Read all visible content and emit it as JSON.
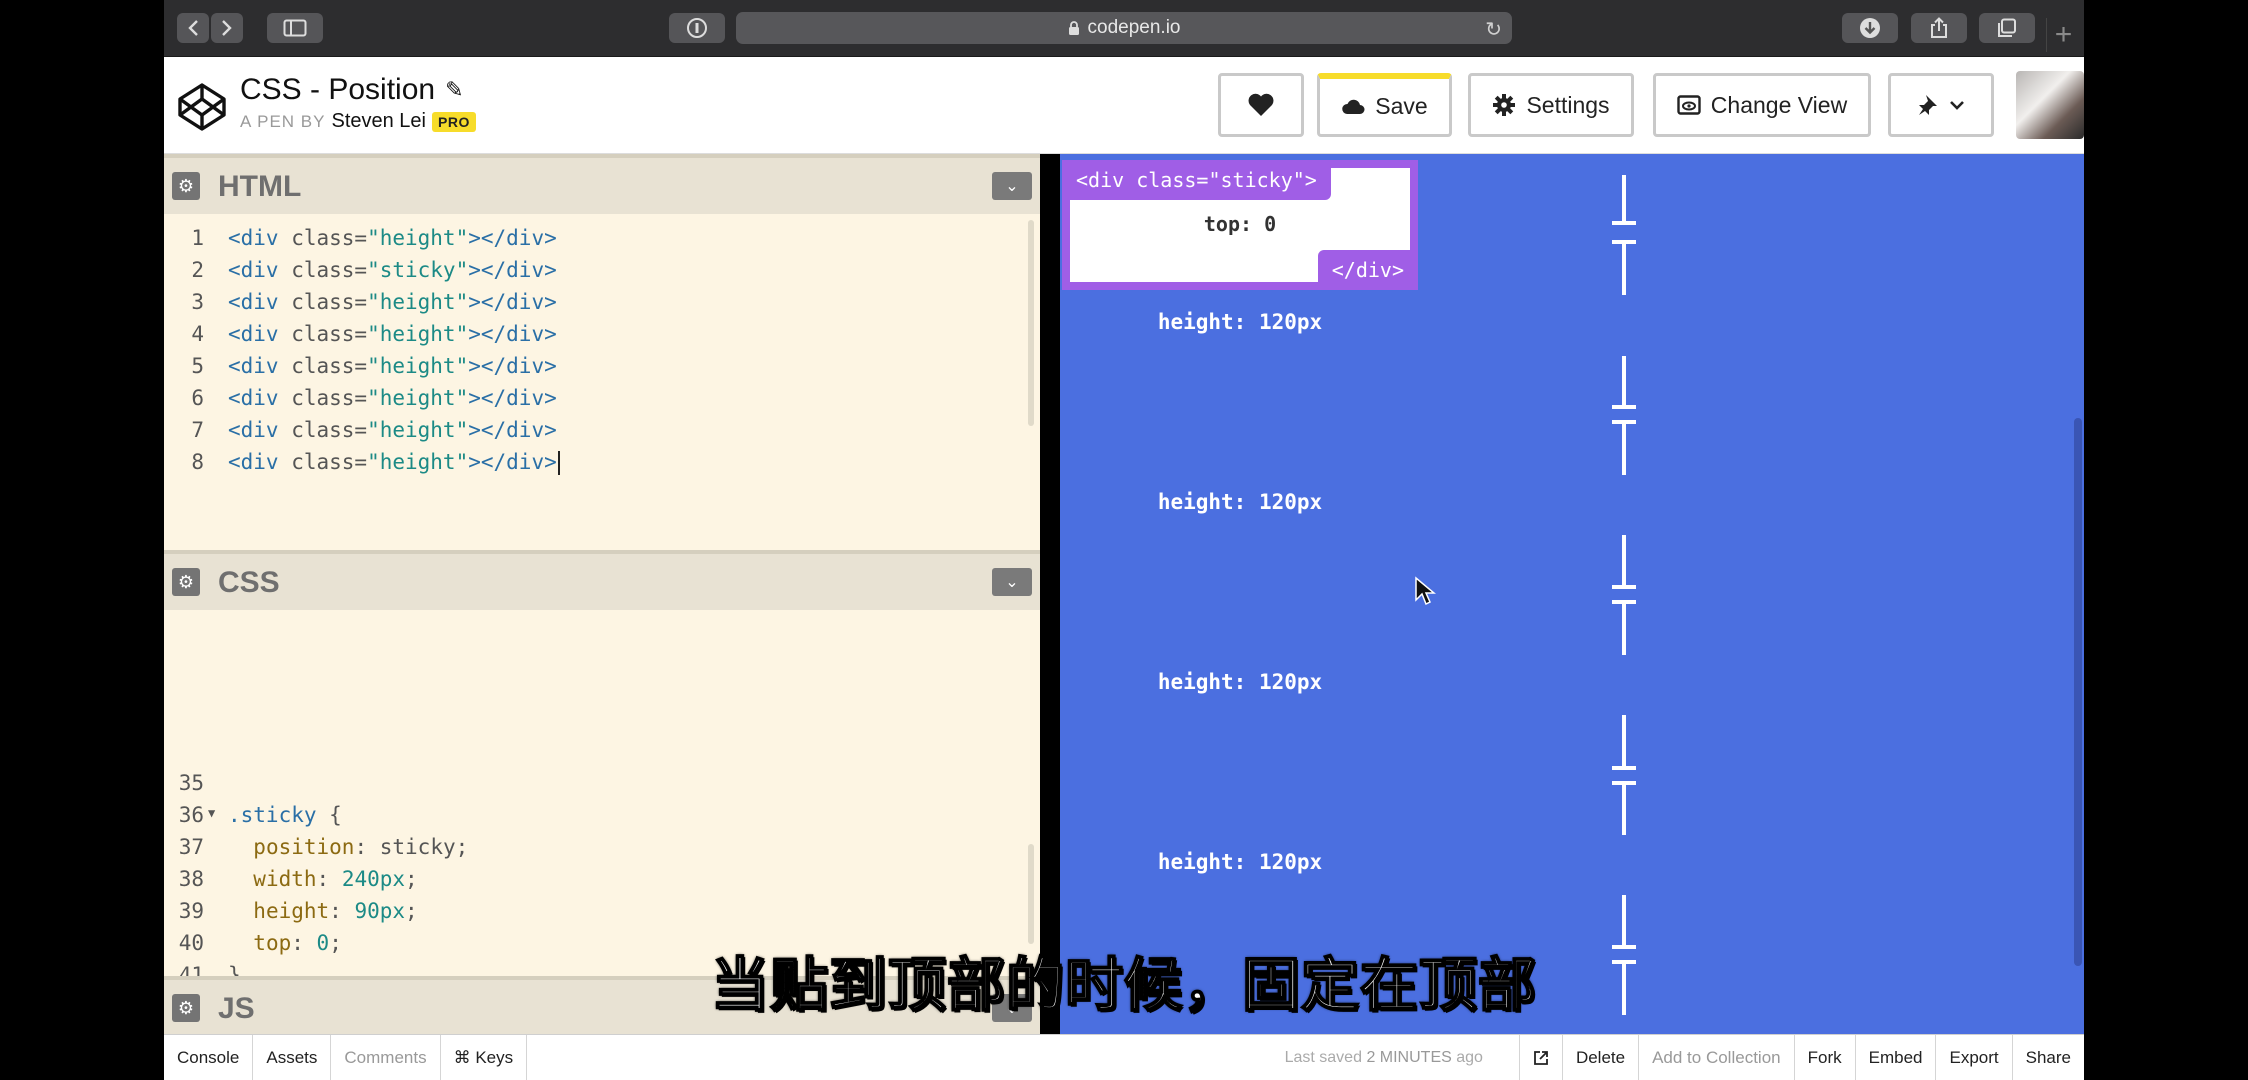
{
  "browser": {
    "url": "codepen.io"
  },
  "header": {
    "title": "CSS - Position",
    "byline_prefix": "A PEN BY",
    "author": "Steven Lei",
    "badge": "PRO",
    "buttons": {
      "save": "Save",
      "settings": "Settings",
      "change_view": "Change View"
    }
  },
  "html_editor": {
    "title": "HTML",
    "lines": [
      {
        "n": "1",
        "open": "<div ",
        "attr": "class=",
        "val": "\"height\"",
        "close": "></div>"
      },
      {
        "n": "2",
        "open": "<div ",
        "attr": "class=",
        "val": "\"sticky\"",
        "close": "></div>"
      },
      {
        "n": "3",
        "open": "<div ",
        "attr": "class=",
        "val": "\"height\"",
        "close": "></div>"
      },
      {
        "n": "4",
        "open": "<div ",
        "attr": "class=",
        "val": "\"height\"",
        "close": "></div>"
      },
      {
        "n": "5",
        "open": "<div ",
        "attr": "class=",
        "val": "\"height\"",
        "close": "></div>"
      },
      {
        "n": "6",
        "open": "<div ",
        "attr": "class=",
        "val": "\"height\"",
        "close": "></div>"
      },
      {
        "n": "7",
        "open": "<div ",
        "attr": "class=",
        "val": "\"height\"",
        "close": "></div>"
      },
      {
        "n": "8",
        "open": "<div ",
        "attr": "class=",
        "val": "\"height\"",
        "close": "></div>"
      }
    ]
  },
  "css_editor": {
    "title": "CSS",
    "line_numbers": [
      "35",
      "36",
      "37",
      "38",
      "39",
      "40",
      "41"
    ],
    "selector": ".sticky",
    "brace_open": " {",
    "declarations": [
      {
        "prop": "position",
        "value": "sticky"
      },
      {
        "prop": "width",
        "value": "240px"
      },
      {
        "prop": "height",
        "value": "90px"
      },
      {
        "prop": "top",
        "value": "0"
      }
    ],
    "brace_close": "}"
  },
  "js_editor": {
    "title": "JS"
  },
  "preview": {
    "sticky_open_tag": "<div class=\"sticky\">",
    "sticky_close_tag": "</div>",
    "sticky_text": "top: 0",
    "height_labels": [
      "height: 120px",
      "height: 120px",
      "height: 120px",
      "height: 120px"
    ]
  },
  "subtitle": "当贴到顶部的时候，固定在顶部",
  "footer": {
    "console": "Console",
    "assets": "Assets",
    "comments": "Comments",
    "keys": "⌘ Keys",
    "saved_prefix": "Last saved",
    "saved_time": "2 MINUTES",
    "saved_suffix": "ago",
    "delete": "Delete",
    "add_to_collection": "Add to Collection",
    "fork": "Fork",
    "embed": "Embed",
    "export": "Export",
    "share": "Share"
  }
}
